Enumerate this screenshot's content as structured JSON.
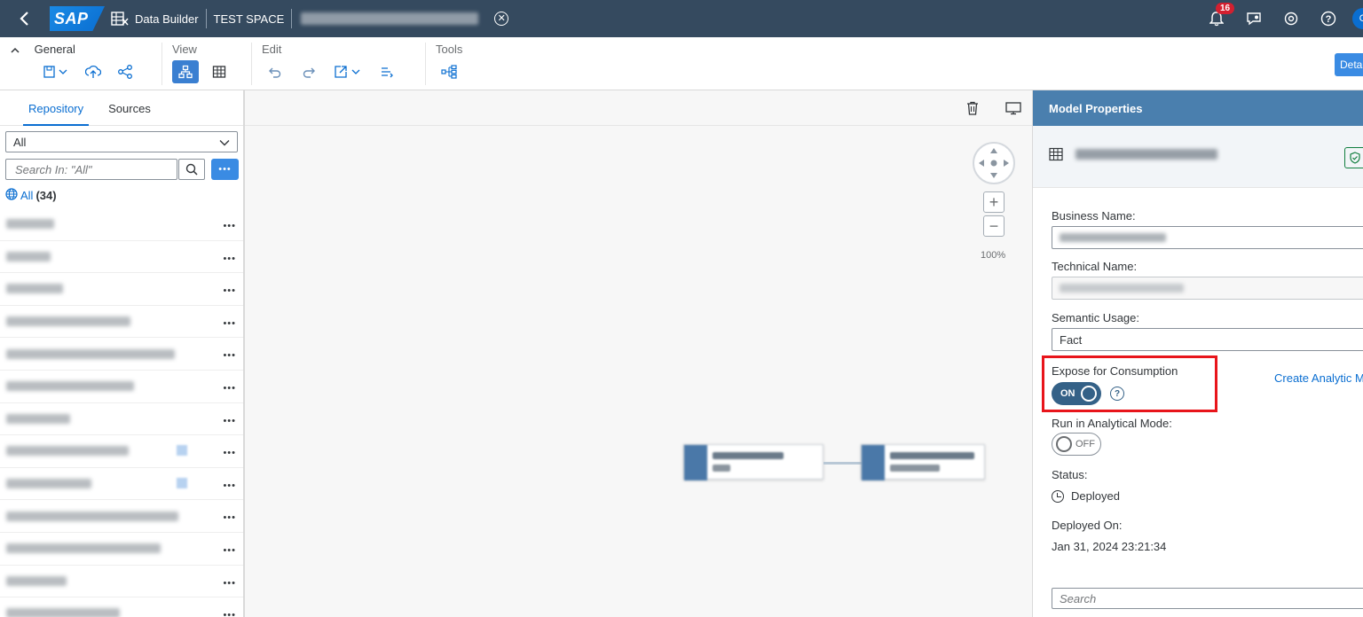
{
  "shell": {
    "logo": "SAP",
    "app_title": "Data Builder",
    "space": "TEST SPACE",
    "notification_count": "16",
    "avatar": "G"
  },
  "toolbar": {
    "groups": [
      {
        "label": "General"
      },
      {
        "label": "View"
      },
      {
        "label": "Edit"
      },
      {
        "label": "Tools"
      }
    ],
    "details_button": "Deta"
  },
  "left_panel": {
    "tabs": [
      "Repository",
      "Sources"
    ],
    "filter_value": "All",
    "search_placeholder": "Search In: \"All\"",
    "all_label": "All",
    "all_count": "(34)",
    "more_label": "•••"
  },
  "canvas": {
    "zoom": "100%"
  },
  "properties": {
    "title": "Model Properties",
    "business_name_label": "Business Name:",
    "technical_name_label": "Technical Name:",
    "semantic_usage_label": "Semantic Usage:",
    "semantic_usage_value": "Fact",
    "expose_label": "Expose for Consumption",
    "expose_toggle": "ON",
    "create_link": "Create Analytic M",
    "analytical_mode_label": "Run in Analytical Mode:",
    "analytical_mode_toggle": "OFF",
    "status_label": "Status:",
    "status_value": "Deployed",
    "deployed_on_label": "Deployed On:",
    "deployed_on_value": "Jan 31, 2024 23:21:34",
    "search_placeholder": "Search"
  },
  "colors": {
    "shell_bg": "#354a5f",
    "accent": "#0a6ed1",
    "panel_header": "#4a7fae",
    "highlight": "#e8151b"
  }
}
